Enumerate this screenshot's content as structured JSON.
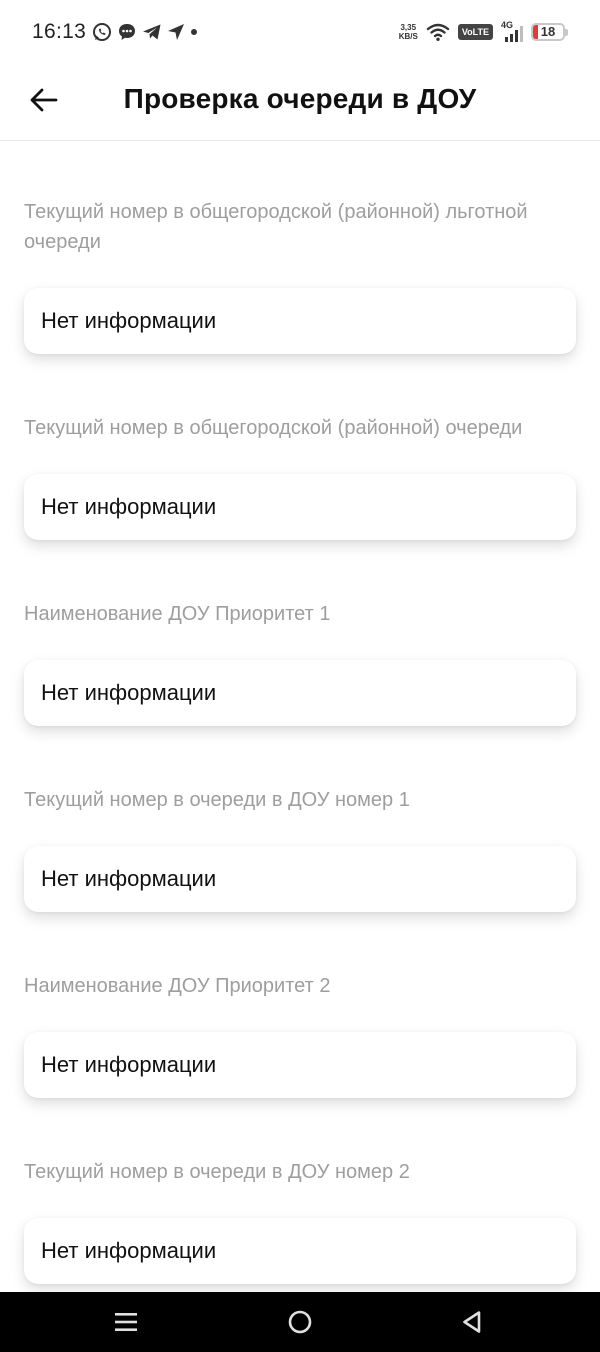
{
  "status_bar": {
    "time": "16:13",
    "speed_value": "3,35",
    "speed_unit": "KB/S",
    "volte": "VoLTE",
    "network": "4G",
    "battery": "18",
    "battery_level_percent": 18,
    "battery_color": "#e53935"
  },
  "header": {
    "back_icon": "arrow-left-icon",
    "title": "Проверка очереди в ДОУ"
  },
  "fields": [
    {
      "label": "Текущий номер в общегородской (районной) льготной очереди",
      "value": "Нет информации"
    },
    {
      "label": "Текущий номер в общегородской (районной) очереди",
      "value": "Нет информации"
    },
    {
      "label": "Наименование ДОУ Приоритет 1",
      "value": "Нет информации"
    },
    {
      "label": "Текущий номер в очереди в ДОУ номер 1",
      "value": "Нет информации"
    },
    {
      "label": "Наименование ДОУ Приоритет 2",
      "value": "Нет информации"
    },
    {
      "label": "Текущий номер в очереди в ДОУ номер 2",
      "value": "Нет информации"
    }
  ],
  "nav": {
    "menu_icon": "menu-icon",
    "home_icon": "home-circle-icon",
    "back_icon": "back-triangle-icon"
  },
  "colors": {
    "label": "#9e9e9e",
    "text": "#111111",
    "nav_bg": "#000000"
  }
}
